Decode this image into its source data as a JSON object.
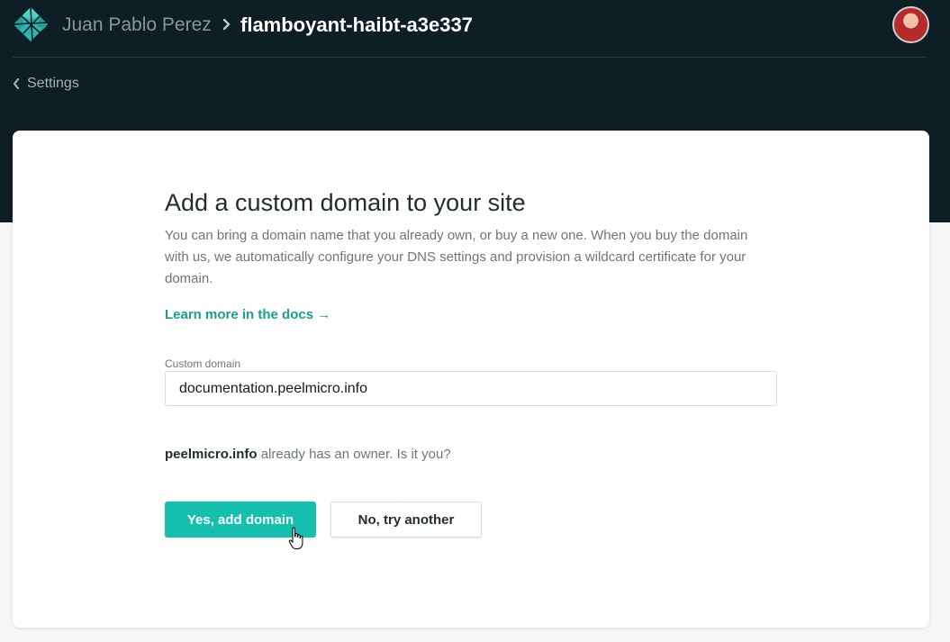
{
  "header": {
    "team_name": "Juan Pablo Perez",
    "site_name": "flamboyant-haibt-a3e337"
  },
  "nav": {
    "back_label": "Settings"
  },
  "card": {
    "title": "Add a custom domain to your site",
    "description": "You can bring a domain name that you already own, or buy a new one. When you buy the domain with us, we automatically configure your DNS settings and provision a wildcard certificate for your domain.",
    "docs_link": "Learn more in the docs →",
    "field_label": "Custom domain",
    "domain_value": "documentation.peelmicro.info",
    "owner_domain": "peelmicro.info",
    "owner_question": " already has an owner. Is it you?",
    "confirm_label": "Yes, add domain",
    "reject_label": "No, try another"
  },
  "colors": {
    "header_bg": "#0e1e25",
    "accent": "#15bfae",
    "link": "#1a9e94"
  },
  "icons": [
    "netlify-logo-icon",
    "chevron-right-icon",
    "chevron-left-icon",
    "avatar",
    "hand-cursor-icon"
  ]
}
